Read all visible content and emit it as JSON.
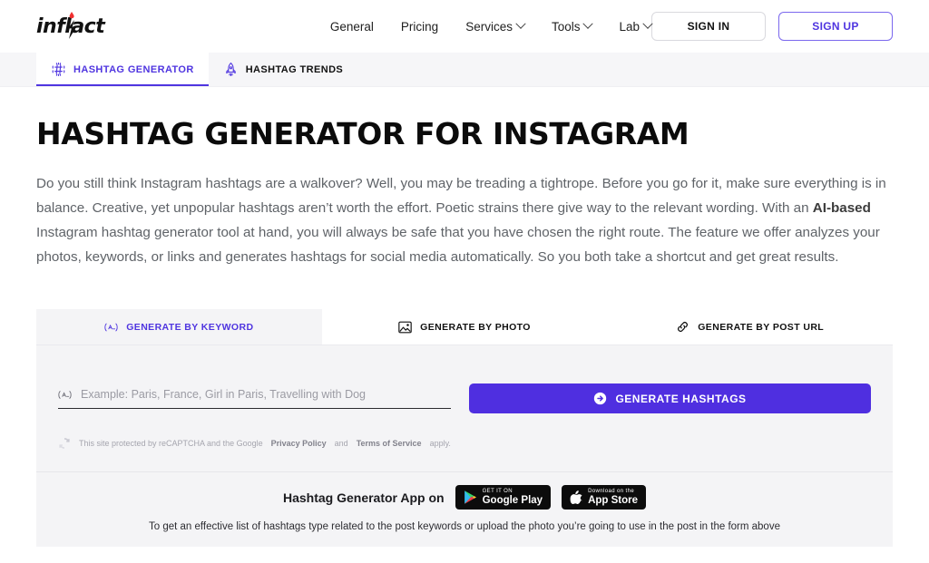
{
  "header": {
    "logo_text": "inflact",
    "logo_icon": "lightning-bolt-drop-icon",
    "nav": [
      {
        "label": "General",
        "has_chevron": false
      },
      {
        "label": "Pricing",
        "has_chevron": false
      },
      {
        "label": "Services",
        "has_chevron": true
      },
      {
        "label": "Tools",
        "has_chevron": true
      },
      {
        "label": "Lab",
        "has_chevron": true
      }
    ],
    "sign_in": "SIGN IN",
    "sign_up": "SIGN UP"
  },
  "subnav": {
    "items": [
      {
        "label": "HASHTAG GENERATOR",
        "icon": "hashtag-sparkle-icon",
        "active": true
      },
      {
        "label": "HASHTAG TRENDS",
        "icon": "rocket-icon",
        "active": false
      }
    ]
  },
  "main": {
    "title": "HASHTAG GENERATOR FOR INSTAGRAM",
    "intro_part1": "Do you still think Instagram hashtags are a walkover? Well, you may be treading a tightrope. Before you go for it, make sure everything is in balance. Creative, yet unpopular hashtags aren’t worth the effort. Poetic strains there give way to the relevant wording. With an ",
    "intro_bold": "AI-based",
    "intro_part2": " Instagram hashtag generator tool at hand, you will always be safe that you have chosen the right route. The feature we offer analyzes your photos, keywords, or links and generates hashtags for social media automatically. So you both take a shortcut and get great results."
  },
  "widget": {
    "tabs": [
      {
        "label": "GENERATE BY KEYWORD",
        "icon": "keyword-text-icon",
        "active": true
      },
      {
        "label": "GENERATE BY PHOTO",
        "icon": "photo-image-icon",
        "active": false
      },
      {
        "label": "GENERATE BY POST URL",
        "icon": "link-chain-icon",
        "active": false
      }
    ],
    "input": {
      "value": "",
      "placeholder": "Example: Paris, France, Girl in Paris, Travelling with Dog",
      "icon": "keyword-text-icon"
    },
    "generate_button": {
      "label": "GENERATE HASHTAGS",
      "icon": "arrow-right-circle-icon",
      "color": "#4f2fe0"
    },
    "recaptcha": {
      "icon": "recaptcha-icon",
      "text_before": "This site protected by reCAPTCHA and the Google ",
      "link1": "Privacy Policy",
      "text_middle": " and ",
      "link2": "Terms of Service",
      "text_after": " apply."
    }
  },
  "appbar": {
    "label": "Hashtag Generator App on",
    "google_play": {
      "small": "GET IT ON",
      "big": "Google Play",
      "icon": "google-play-icon"
    },
    "app_store": {
      "small": "Download on the",
      "big": "App Store",
      "icon": "apple-icon"
    },
    "note": "To get an effective list of hashtags type related to the post keywords or upload the photo you’re going to use in the post in the form above"
  },
  "colors": {
    "accent": "#4f35e0",
    "button": "#4f2fe0",
    "panel": "#f4f4f6",
    "text": "#5f6368"
  }
}
